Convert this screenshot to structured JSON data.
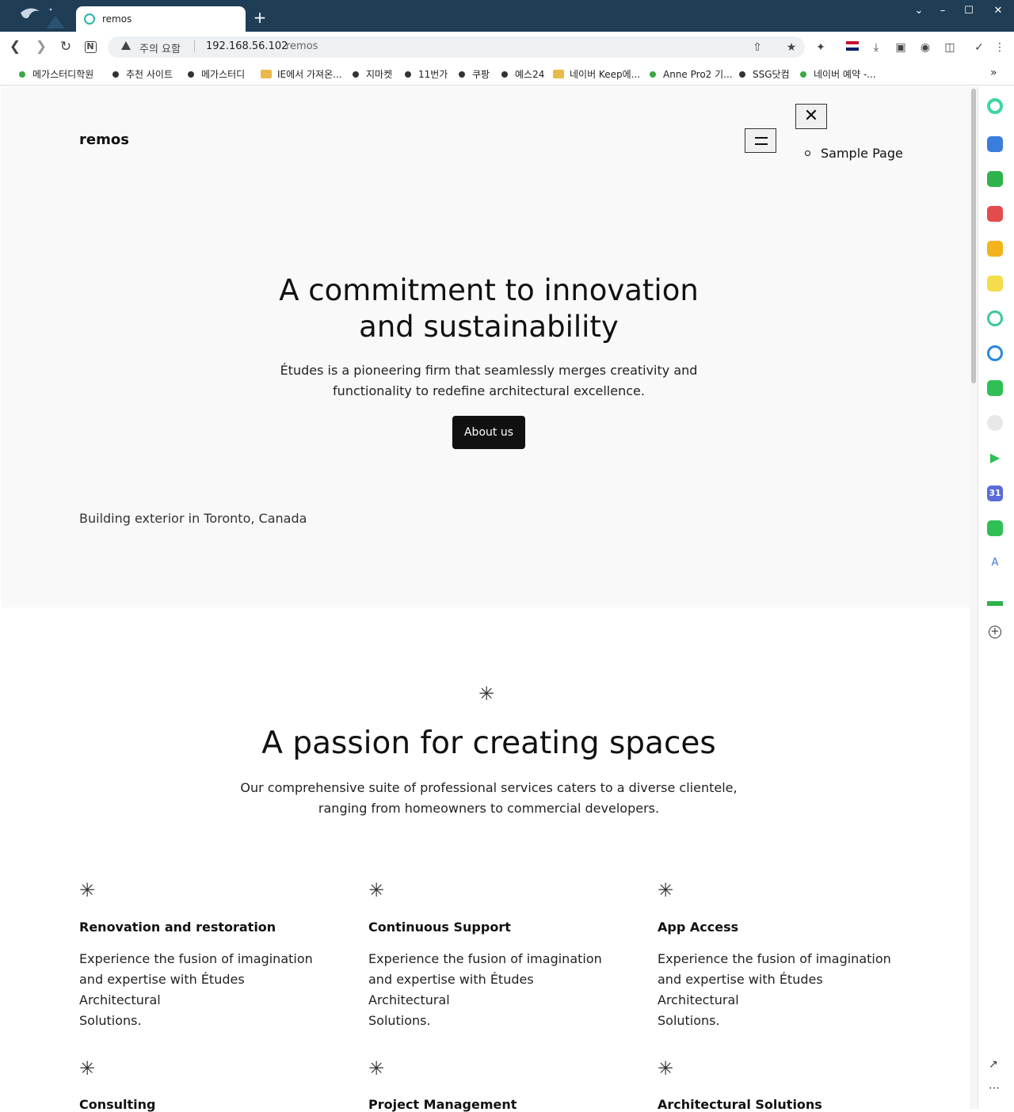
{
  "browser": {
    "tab_title": "remos",
    "new_tab": "+",
    "security_warning": "주의 요함",
    "url_host": "192.168.56.102",
    "url_path": "remos",
    "bookmarks": [
      {
        "label": "메가스터디학원",
        "icon": "green-dot"
      },
      {
        "label": "추천 사이트",
        "icon": "dot"
      },
      {
        "label": "메가스터디",
        "icon": "dot"
      },
      {
        "label": "IE에서 가져온...",
        "icon": "folder"
      },
      {
        "label": "지마켓",
        "icon": "dot"
      },
      {
        "label": "11번가",
        "icon": "dot"
      },
      {
        "label": "쿠팡",
        "icon": "dot"
      },
      {
        "label": "예스24",
        "icon": "dot"
      },
      {
        "label": "네이버 Keep에...",
        "icon": "folder"
      },
      {
        "label": "Anne Pro2 기...",
        "icon": "green-dot"
      },
      {
        "label": "SSG닷컴",
        "icon": "dot"
      },
      {
        "label": "네이버 예약 -...",
        "icon": "green-dot"
      }
    ],
    "bookmarks_more": "»",
    "sidebar_calendar_badge": "31",
    "sidebar_translate_badge": "A"
  },
  "site": {
    "title": "remos",
    "menu_item": "Sample Page"
  },
  "hero": {
    "title_line1": "A commitment to innovation",
    "title_line2": "and sustainability",
    "text_line1": "Études is a pioneering firm that seamlessly merges creativity and",
    "text_line2": "functionality to redefine architectural excellence.",
    "button": "About us",
    "image_alt": "Building exterior in Toronto, Canada"
  },
  "services_section": {
    "title": "A passion for creating spaces",
    "text_line1": "Our comprehensive suite of professional services caters to a diverse clientele,",
    "text_line2": "ranging from homeowners to commercial developers.",
    "items": [
      {
        "title": "Renovation and restoration",
        "line1": "Experience the fusion of imagination",
        "line2": "and expertise with Études Architectural",
        "line3": "Solutions."
      },
      {
        "title": "Continuous Support",
        "line1": "Experience the fusion of imagination",
        "line2": "and expertise with Études Architectural",
        "line3": "Solutions."
      },
      {
        "title": "App Access",
        "line1": "Experience the fusion of imagination",
        "line2": "and expertise with Études Architectural",
        "line3": "Solutions."
      },
      {
        "title": "Consulting"
      },
      {
        "title": "Project Management"
      },
      {
        "title": "Architectural Solutions"
      }
    ]
  },
  "colors": {
    "titlebar": "#1f3d55",
    "hero_bg": "#f9f9f9",
    "button_bg": "#111111"
  }
}
